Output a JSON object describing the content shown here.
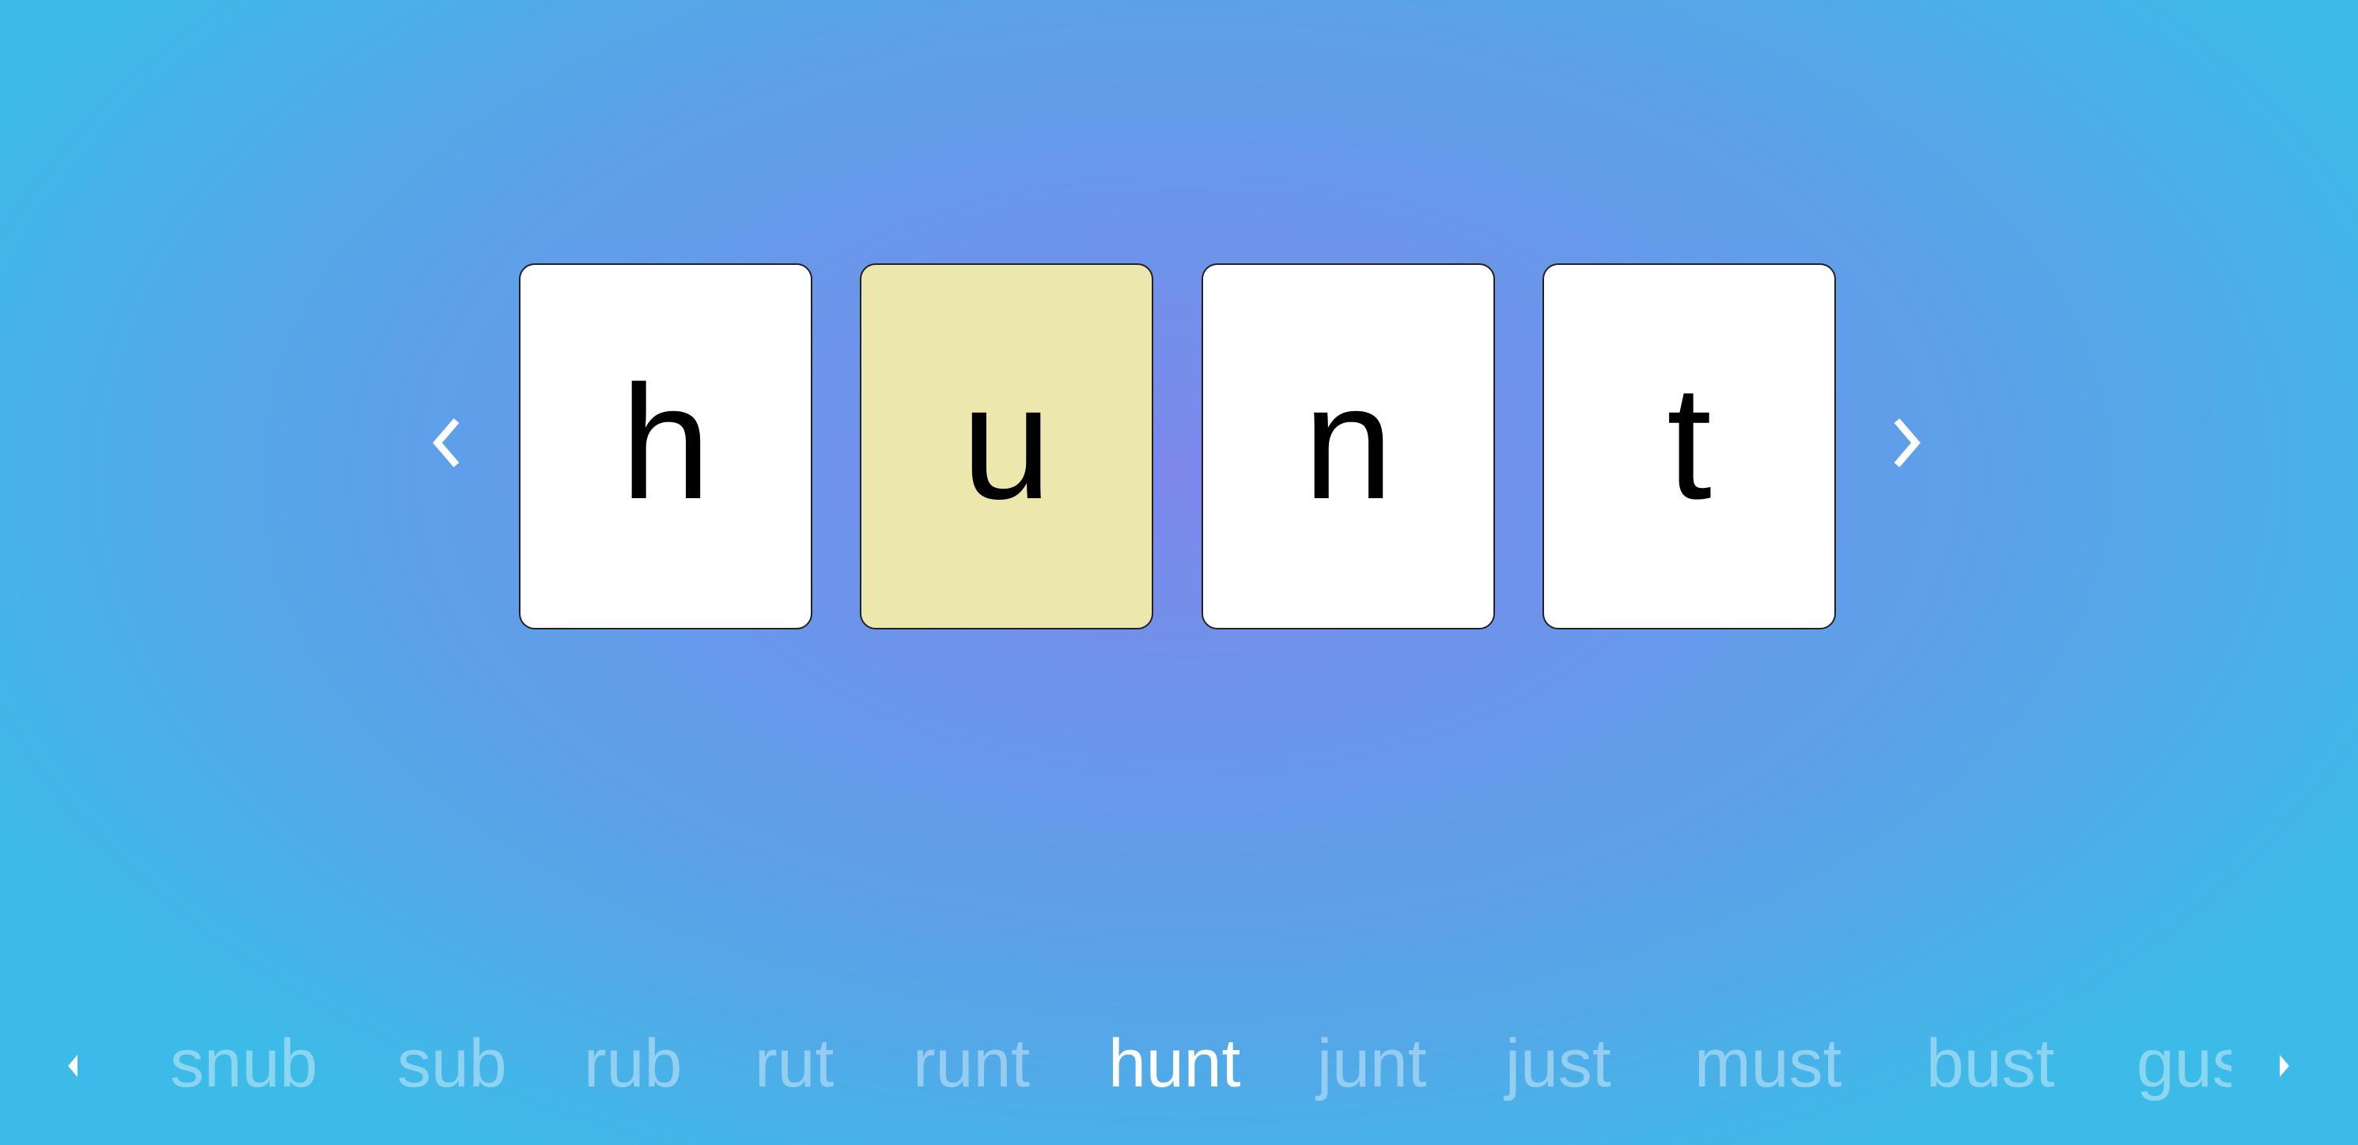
{
  "word": {
    "letters": [
      "h",
      "u",
      "n",
      "t"
    ],
    "selected_index": 1
  },
  "colors": {
    "selected_card": "#ece7ad",
    "card": "#ffffff"
  },
  "word_list": {
    "items": [
      "snub",
      "sub",
      "rub",
      "rut",
      "runt",
      "hunt",
      "junt",
      "just",
      "must",
      "bust",
      "gus"
    ],
    "current": "hunt"
  },
  "icons": {
    "prev": "chevron-left-icon",
    "next": "chevron-right-icon",
    "list_prev": "triangle-left-icon",
    "list_next": "triangle-right-icon"
  }
}
